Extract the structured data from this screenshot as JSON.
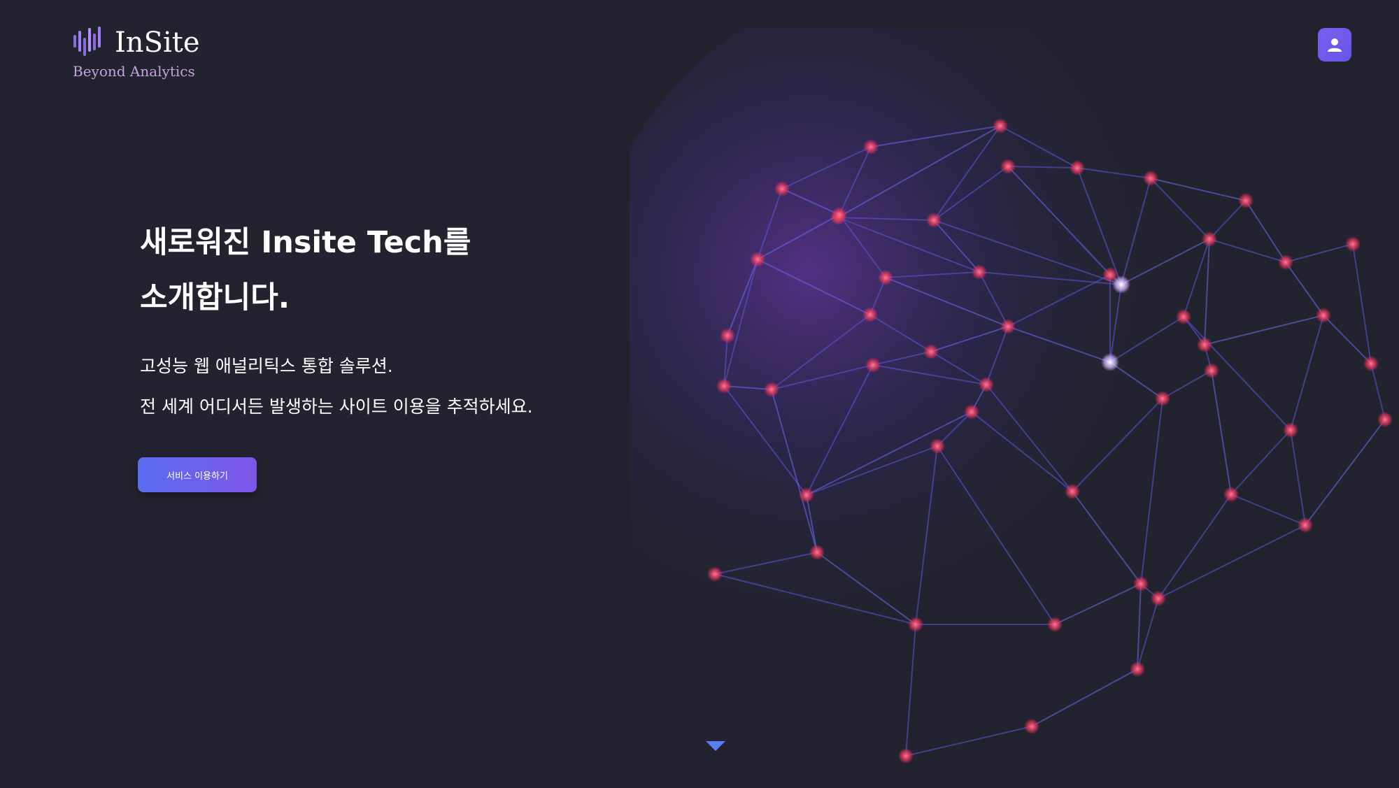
{
  "brand": {
    "name": "InSite",
    "tagline": "Beyond Analytics",
    "logo_icon": "bar-wave-logo-icon",
    "accent_color": "#7b5ce8",
    "tagline_color": "#c5a1e6"
  },
  "header": {
    "profile_icon": "user-icon",
    "profile_button_color": "#7259ef"
  },
  "hero": {
    "headline_line1": "새로워진 Insite Tech를",
    "headline_line2": "소개합니다.",
    "description_line1": "고성능 웹 애널리틱스 통합 솔루션.",
    "description_line2": "전 세계 어디서든 발생하는 사이트 이용을 추적하세요.",
    "cta_label": "서비스 이용하기",
    "background_color": "#23232f"
  },
  "scroll": {
    "icon": "triangle-down-icon",
    "color": "#5b7cf5"
  }
}
